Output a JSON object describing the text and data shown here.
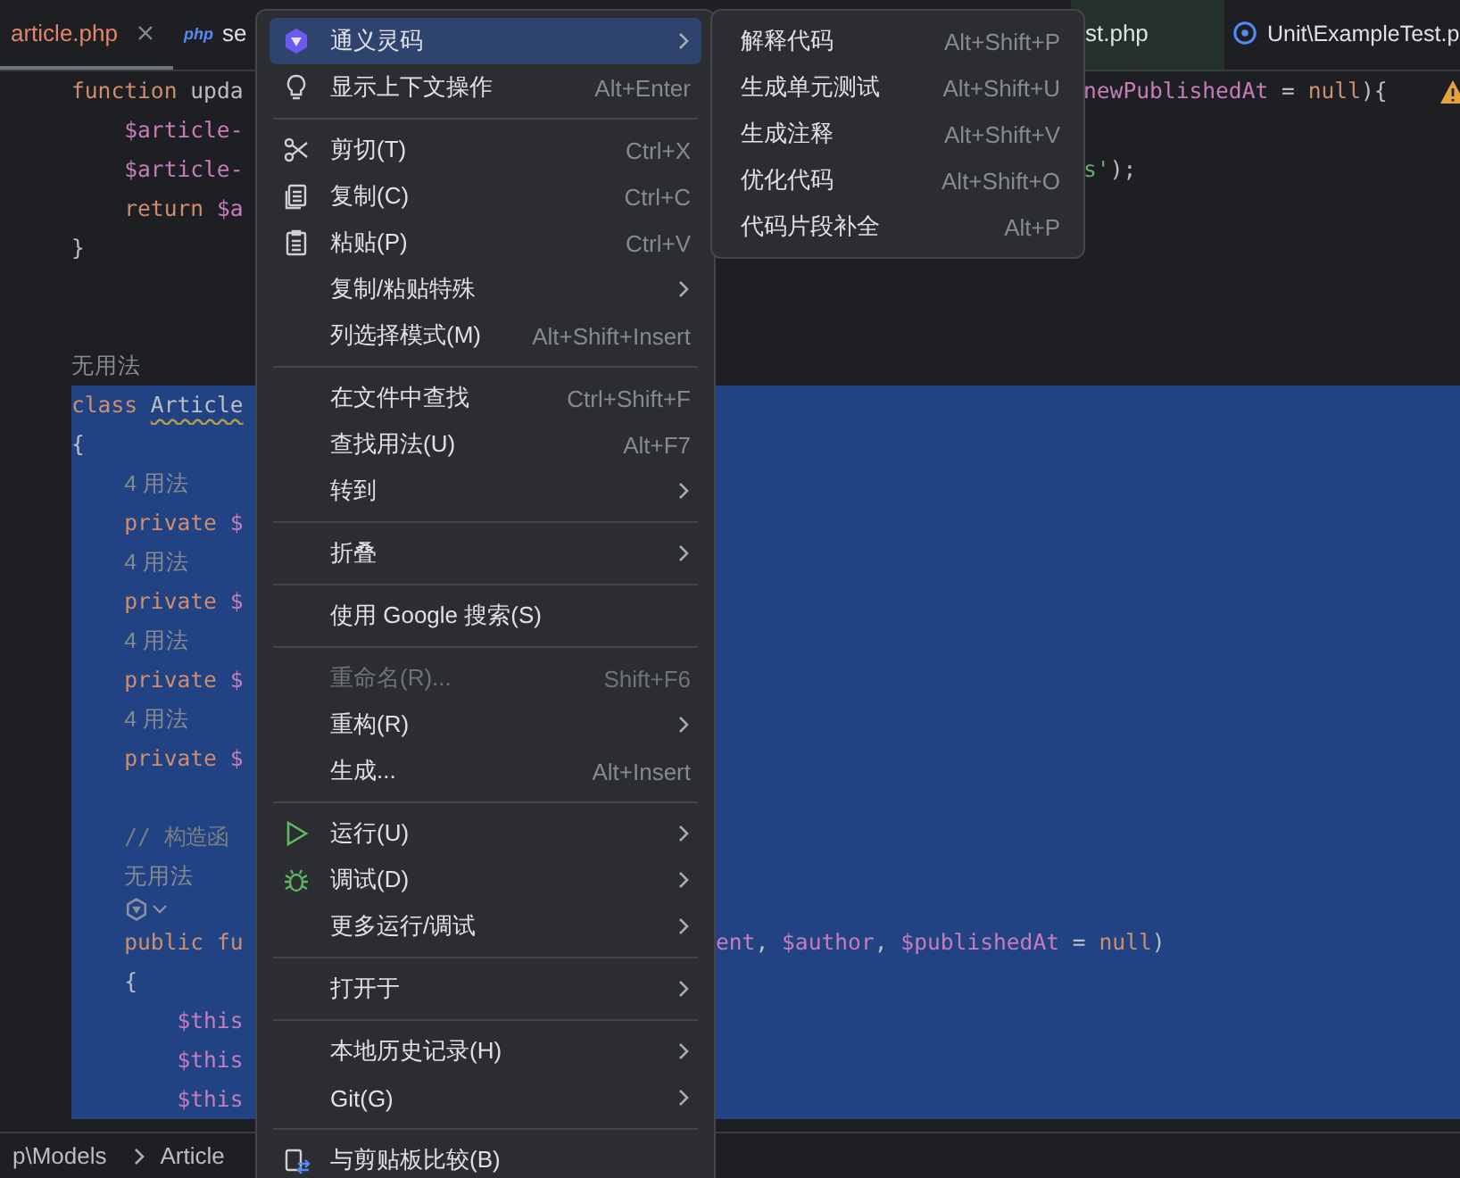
{
  "tabs": [
    {
      "label": "article.php",
      "kind": "plain",
      "selected": true,
      "closable": true
    },
    {
      "label": "se",
      "kind": "php",
      "badge": "php",
      "selected": false
    },
    {
      "label": "st.php",
      "kind": "plain",
      "selected": false
    },
    {
      "label": "Unit\\ExampleTest.p",
      "kind": "test",
      "selected": false
    }
  ],
  "editor": {
    "warning": true,
    "lines": [
      {
        "kind": "code",
        "selected": false,
        "segs": [
          {
            "t": "function ",
            "kind": "kw"
          },
          {
            "t": "upda",
            "kind": "plain"
          }
        ],
        "right": {
          "kind": "after_submenu",
          "segs": [
            {
              "t": "newPublishedAt",
              "kind": "var"
            },
            {
              "t": " = ",
              "kind": "plain"
            },
            {
              "t": "null",
              "kind": "kw"
            },
            {
              "t": "){",
              "kind": "plain"
            }
          ]
        }
      },
      {
        "kind": "code",
        "selected": false,
        "segs": [
          {
            "t": "    $article-",
            "kind": "var"
          }
        ]
      },
      {
        "kind": "code",
        "selected": false,
        "segs": [
          {
            "t": "    $article-",
            "kind": "var"
          }
        ],
        "right": {
          "kind": "after_submenu",
          "segs": [
            {
              "t": "s'",
              "kind": "str"
            },
            {
              "t": ");",
              "kind": "plain"
            }
          ]
        }
      },
      {
        "kind": "code",
        "selected": false,
        "segs": [
          {
            "t": "    return ",
            "kind": "kw"
          },
          {
            "t": "$a",
            "kind": "var"
          }
        ]
      },
      {
        "kind": "code",
        "selected": false,
        "segs": [
          {
            "t": "}",
            "kind": "plain"
          }
        ]
      },
      {
        "kind": "blank",
        "selected": false
      },
      {
        "kind": "blank",
        "selected": false
      },
      {
        "kind": "hint",
        "selected": false,
        "text": "无用法"
      },
      {
        "kind": "code",
        "selected": true,
        "segs": [
          {
            "t": "class ",
            "kind": "kw"
          },
          {
            "t": "Article",
            "kind": "warn"
          }
        ]
      },
      {
        "kind": "code",
        "selected": true,
        "segs": [
          {
            "t": "{",
            "kind": "plain"
          }
        ]
      },
      {
        "kind": "hint",
        "selected": true,
        "text": "    4 用法"
      },
      {
        "kind": "code",
        "selected": true,
        "segs": [
          {
            "t": "    private ",
            "kind": "kw"
          },
          {
            "t": "$",
            "kind": "var"
          }
        ]
      },
      {
        "kind": "hint",
        "selected": true,
        "text": "    4 用法"
      },
      {
        "kind": "code",
        "selected": true,
        "segs": [
          {
            "t": "    private ",
            "kind": "kw"
          },
          {
            "t": "$",
            "kind": "var"
          }
        ]
      },
      {
        "kind": "hint",
        "selected": true,
        "text": "    4 用法"
      },
      {
        "kind": "code",
        "selected": true,
        "segs": [
          {
            "t": "    private ",
            "kind": "kw"
          },
          {
            "t": "$",
            "kind": "var"
          }
        ]
      },
      {
        "kind": "hint",
        "selected": true,
        "text": "    4 用法"
      },
      {
        "kind": "code",
        "selected": true,
        "segs": [
          {
            "t": "    private ",
            "kind": "kw"
          },
          {
            "t": "$",
            "kind": "var"
          }
        ]
      },
      {
        "kind": "blank",
        "selected": true
      },
      {
        "kind": "code",
        "selected": true,
        "segs": [
          {
            "t": "    // 构造函",
            "kind": "comment"
          }
        ]
      },
      {
        "kind": "hint",
        "selected": true,
        "text": "    无用法"
      },
      {
        "kind": "ai_actions",
        "selected": true
      },
      {
        "kind": "code",
        "selected": true,
        "segs": [
          {
            "t": "    public ",
            "kind": "kw"
          },
          {
            "t": "fu",
            "kind": "kw"
          }
        ],
        "right": {
          "kind": "after_menu",
          "segs": [
            {
              "t": "ent",
              "kind": "var"
            },
            {
              "t": ", ",
              "kind": "plain"
            },
            {
              "t": "$author",
              "kind": "var"
            },
            {
              "t": ", ",
              "kind": "plain"
            },
            {
              "t": "$publishedAt",
              "kind": "var"
            },
            {
              "t": " = ",
              "kind": "plain"
            },
            {
              "t": "null",
              "kind": "kw"
            },
            {
              "t": ")",
              "kind": "plain"
            }
          ]
        }
      },
      {
        "kind": "code",
        "selected": true,
        "segs": [
          {
            "t": "    {",
            "kind": "plain"
          }
        ]
      },
      {
        "kind": "code",
        "selected": true,
        "segs": [
          {
            "t": "        $this",
            "kind": "var"
          }
        ]
      },
      {
        "kind": "code",
        "selected": true,
        "segs": [
          {
            "t": "        $this",
            "kind": "var"
          }
        ]
      },
      {
        "kind": "code",
        "selected": true,
        "segs": [
          {
            "t": "        $this",
            "kind": "var"
          }
        ]
      }
    ]
  },
  "breadcrumb": [
    {
      "label": "p\\Models"
    },
    {
      "label": "Article"
    }
  ],
  "context_menu": {
    "groups": [
      [
        {
          "kind": "tongyi",
          "label": "通义灵码",
          "submenu": true,
          "selected": true,
          "disabled": false
        },
        {
          "kind": "bulb",
          "label": "显示上下文操作",
          "shortcut": "Alt+Enter",
          "submenu": false,
          "selected": false,
          "disabled": false
        }
      ],
      [
        {
          "kind": "scissors",
          "label": "剪切(T)",
          "shortcut": "Ctrl+X",
          "submenu": false,
          "selected": false,
          "disabled": false
        },
        {
          "kind": "copy",
          "label": "复制(C)",
          "shortcut": "Ctrl+C",
          "submenu": false,
          "selected": false,
          "disabled": false
        },
        {
          "kind": "paste",
          "label": "粘贴(P)",
          "shortcut": "Ctrl+V",
          "submenu": false,
          "selected": false,
          "disabled": false
        },
        {
          "kind": "plain",
          "label": "复制/粘贴特殊",
          "submenu": true,
          "selected": false,
          "disabled": false
        },
        {
          "kind": "plain",
          "label": "列选择模式(M)",
          "shortcut": "Alt+Shift+Insert",
          "submenu": false,
          "selected": false,
          "disabled": false
        }
      ],
      [
        {
          "kind": "plain",
          "label": "在文件中查找",
          "shortcut": "Ctrl+Shift+F",
          "submenu": false,
          "selected": false,
          "disabled": false
        },
        {
          "kind": "plain",
          "label": "查找用法(U)",
          "shortcut": "Alt+F7",
          "submenu": false,
          "selected": false,
          "disabled": false
        },
        {
          "kind": "plain",
          "label": "转到",
          "submenu": true,
          "selected": false,
          "disabled": false
        }
      ],
      [
        {
          "kind": "plain",
          "label": "折叠",
          "submenu": true,
          "selected": false,
          "disabled": false
        }
      ],
      [
        {
          "kind": "plain",
          "label": "使用 Google 搜索(S)",
          "submenu": false,
          "selected": false,
          "disabled": false
        }
      ],
      [
        {
          "kind": "plain",
          "label": "重命名(R)...",
          "shortcut": "Shift+F6",
          "submenu": false,
          "selected": false,
          "disabled": true
        },
        {
          "kind": "plain",
          "label": "重构(R)",
          "submenu": true,
          "selected": false,
          "disabled": false
        },
        {
          "kind": "plain",
          "label": "生成...",
          "shortcut": "Alt+Insert",
          "submenu": false,
          "selected": false,
          "disabled": false
        }
      ],
      [
        {
          "kind": "run",
          "label": "运行(U)",
          "submenu": true,
          "selected": false,
          "disabled": false
        },
        {
          "kind": "bug",
          "label": "调试(D)",
          "submenu": true,
          "selected": false,
          "disabled": false
        },
        {
          "kind": "plain",
          "label": "更多运行/调试",
          "submenu": true,
          "selected": false,
          "disabled": false
        }
      ],
      [
        {
          "kind": "plain",
          "label": "打开于",
          "submenu": true,
          "selected": false,
          "disabled": false
        }
      ],
      [
        {
          "kind": "plain",
          "label": "本地历史记录(H)",
          "submenu": true,
          "selected": false,
          "disabled": false
        },
        {
          "kind": "plain",
          "label": "Git(G)",
          "submenu": true,
          "selected": false,
          "disabled": false
        }
      ],
      [
        {
          "kind": "compare",
          "label": "与剪贴板比较(B)",
          "submenu": false,
          "selected": false,
          "disabled": false
        }
      ]
    ]
  },
  "submenu": {
    "items": [
      {
        "label": "解释代码",
        "shortcut": "Alt+Shift+P",
        "selected": false
      },
      {
        "label": "生成单元测试",
        "shortcut": "Alt+Shift+U",
        "selected": false
      },
      {
        "label": "生成注释",
        "shortcut": "Alt+Shift+V",
        "selected": false
      },
      {
        "label": "优化代码",
        "shortcut": "Alt+Shift+O",
        "selected": false
      },
      {
        "label": "代码片段补全",
        "shortcut": "Alt+P",
        "selected": false
      }
    ]
  }
}
